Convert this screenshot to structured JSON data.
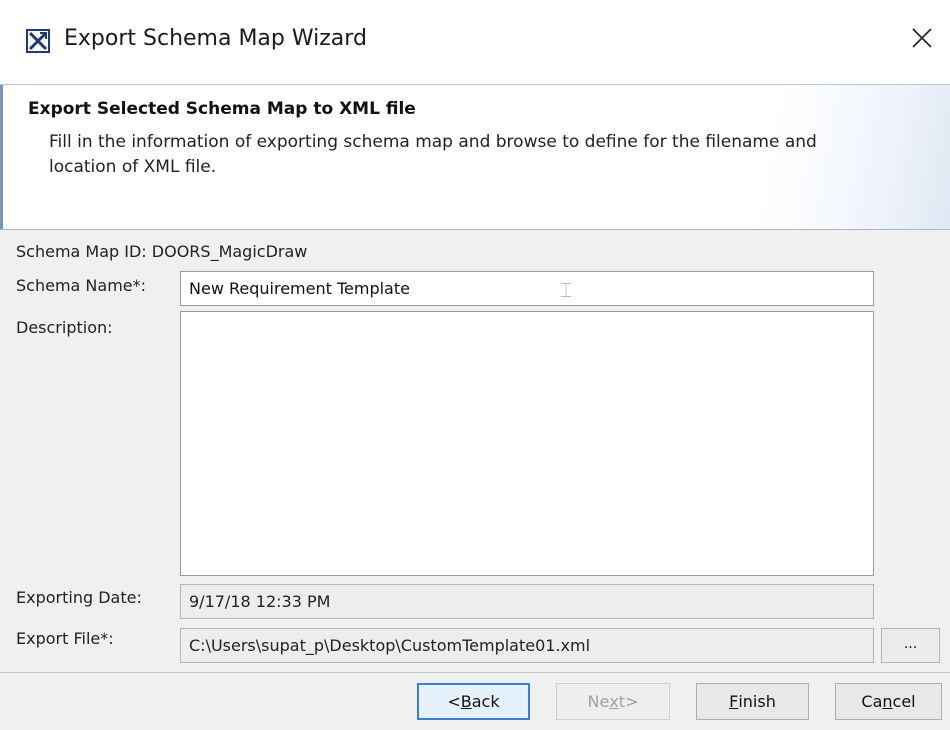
{
  "window": {
    "title": "Export Schema Map Wizard",
    "icon": "export-wizard-icon",
    "close_glyph": "✕"
  },
  "header": {
    "title": "Export Selected Schema Map to XML file",
    "description": "Fill in the information of exporting schema map and browse to define for the filename and location of XML file."
  },
  "form": {
    "schema_map_id_label": "Schema Map ID: DOORS_MagicDraw",
    "schema_name_label": "Schema Name*:",
    "schema_name_value": "New Requirement Template",
    "description_label": "Description:",
    "description_value": "",
    "exporting_date_label": "Exporting Date:",
    "exporting_date_value": "9/17/18 12:33 PM",
    "export_file_label": "Export File*:",
    "export_file_value": "C:\\Users\\supat_p\\Desktop\\CustomTemplate01.xml",
    "browse_label": "..."
  },
  "buttons": {
    "back": {
      "prefix": "<",
      "mnemonic": "B",
      "rest": "ack"
    },
    "next": {
      "prefix": "Ne",
      "mnemonic": "x",
      "rest": "t>"
    },
    "finish": {
      "prefix": "",
      "mnemonic": "F",
      "rest": "inish"
    },
    "cancel": {
      "prefix": "Ca",
      "mnemonic": "n",
      "rest": "cel"
    }
  },
  "colors": {
    "default_button_border": "#3c7fd6",
    "header_accent": "#7a93bd"
  }
}
